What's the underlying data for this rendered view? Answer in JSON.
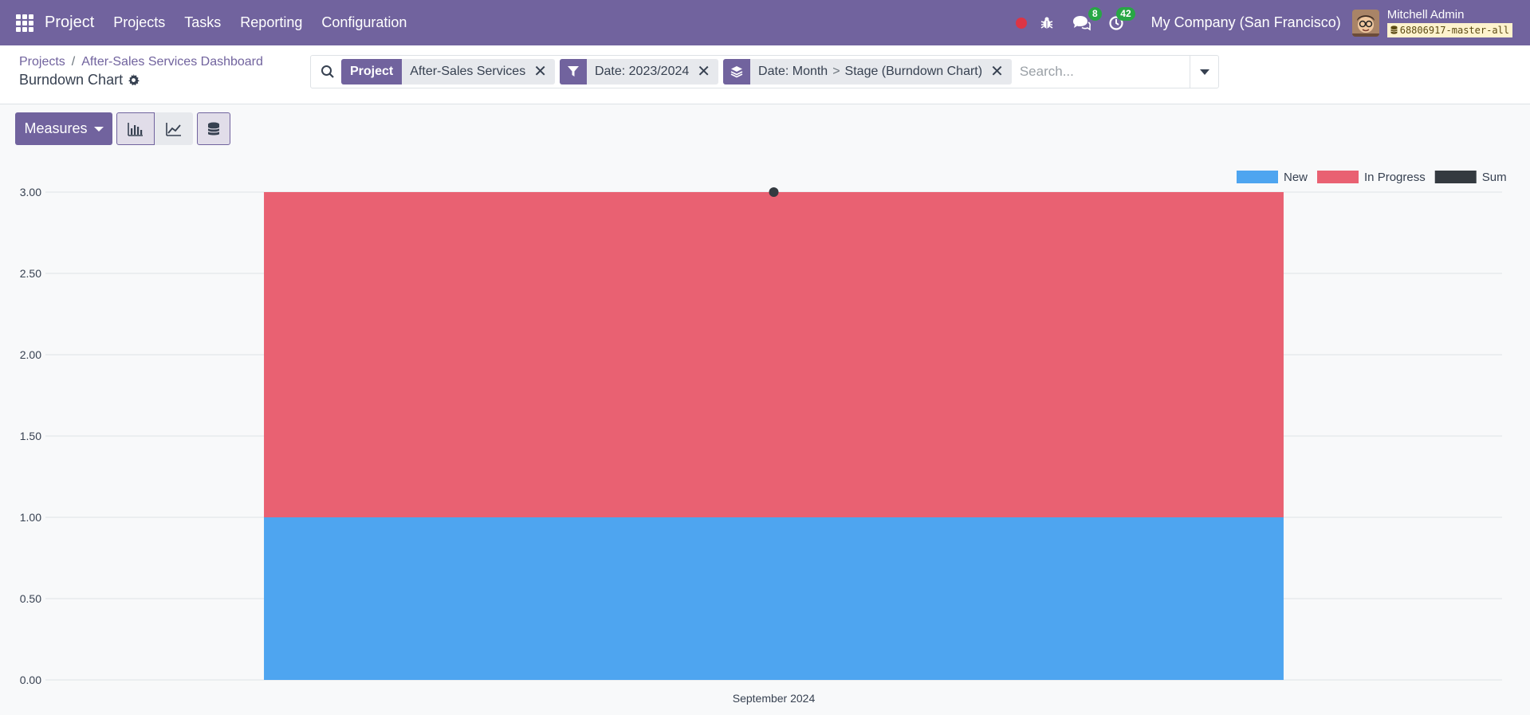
{
  "navbar": {
    "brand": "Project",
    "menu": [
      "Projects",
      "Tasks",
      "Reporting",
      "Configuration"
    ],
    "messages_badge": "8",
    "activities_badge": "42",
    "company": "My Company (San Francisco)",
    "user_name": "Mitchell Admin",
    "database": "68806917-master-all"
  },
  "breadcrumb": {
    "items": [
      "Projects",
      "After-Sales Services Dashboard"
    ],
    "title": "Burndown Chart"
  },
  "search": {
    "facets": [
      {
        "label": "Project",
        "value": "After-Sales Services"
      },
      {
        "icon": "filter-icon",
        "value": "Date: 2023/2024"
      },
      {
        "icon": "layers-icon",
        "value_parts": [
          "Date: Month",
          ">",
          "Stage (Burndown Chart)"
        ]
      }
    ],
    "placeholder": "Search..."
  },
  "toolbar": {
    "measures_label": "Measures"
  },
  "colors": {
    "brand": "#71639e",
    "new": "#4ea5f0",
    "in_progress": "#e96172",
    "sum": "#343a40"
  },
  "chart_data": {
    "type": "bar",
    "stacked": true,
    "categories": [
      "September 2024"
    ],
    "series": [
      {
        "name": "New",
        "values": [
          1
        ],
        "color": "#4ea5f0"
      },
      {
        "name": "In Progress",
        "values": [
          2
        ],
        "color": "#e96172"
      },
      {
        "name": "Sum",
        "values": [
          3
        ],
        "color": "#343a40",
        "style": "line"
      }
    ],
    "ylim": [
      0,
      3
    ],
    "yticks": [
      "0.00",
      "0.50",
      "1.00",
      "1.50",
      "2.00",
      "2.50",
      "3.00"
    ],
    "legend": "top-right",
    "grid": true
  }
}
